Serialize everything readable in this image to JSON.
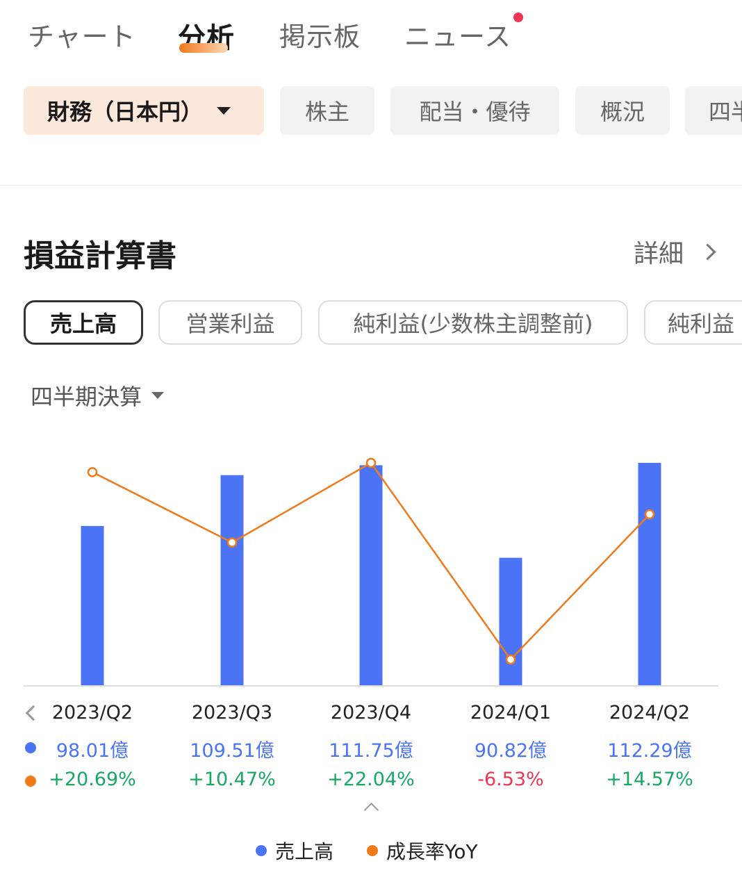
{
  "top_tabs": [
    {
      "label": "チャート"
    },
    {
      "label": "分析"
    },
    {
      "label": "掲示板"
    },
    {
      "label": "ニュース"
    }
  ],
  "category_chips": [
    {
      "label": "財務（日本円）"
    },
    {
      "label": "株主"
    },
    {
      "label": "配当・優待"
    },
    {
      "label": "概況"
    },
    {
      "label": "四半"
    }
  ],
  "section": {
    "title": "損益計算書",
    "detail_label": "詳細"
  },
  "metric_pills": [
    {
      "label": "売上高"
    },
    {
      "label": "営業利益"
    },
    {
      "label": "純利益(少数株主調整前)"
    },
    {
      "label": "純利益"
    }
  ],
  "period_select": {
    "label": "四半期決算"
  },
  "colors": {
    "accent": "#f07a1a",
    "bar": "#4a74f5",
    "line": "#f07a1a",
    "positive": "#18a864",
    "negative": "#ee3553"
  },
  "chart_data": {
    "type": "bar",
    "categories": [
      "2023/Q2",
      "2023/Q3",
      "2023/Q4",
      "2024/Q1",
      "2024/Q2"
    ],
    "series": [
      {
        "name": "売上高",
        "type": "bar",
        "values": [
          98.01,
          109.51,
          111.75,
          90.82,
          112.29
        ],
        "labels": [
          "98.01億",
          "109.51億",
          "111.75億",
          "90.82億",
          "112.29億"
        ]
      },
      {
        "name": "成長率YoY",
        "type": "line",
        "values": [
          20.69,
          10.47,
          22.04,
          -6.53,
          14.57
        ],
        "labels": [
          "+20.69%",
          "+10.47%",
          "+22.04%",
          "-6.53%",
          "+14.57%"
        ]
      }
    ],
    "legend": [
      "売上高",
      "成長率YoY"
    ],
    "legend_position": "bottom",
    "grid": false
  }
}
